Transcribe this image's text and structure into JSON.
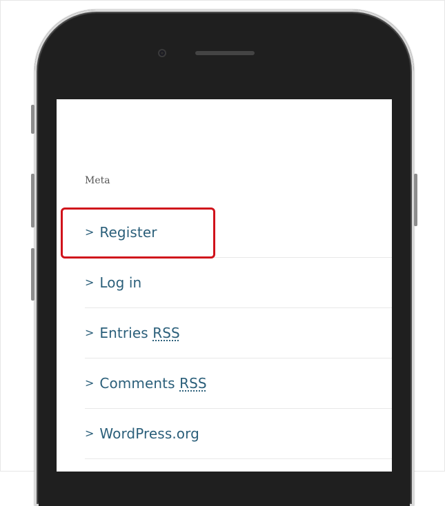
{
  "widget": {
    "title": "Meta",
    "items": [
      {
        "prefix": "Register",
        "abbr": ""
      },
      {
        "prefix": "Log in",
        "abbr": ""
      },
      {
        "prefix": "Entries ",
        "abbr": "RSS"
      },
      {
        "prefix": "Comments ",
        "abbr": "RSS"
      },
      {
        "prefix": "WordPress.org",
        "abbr": ""
      }
    ]
  },
  "icons": {
    "chevron": "chevron-right-icon",
    "camera": "front-camera-icon",
    "speaker": "earpiece-speaker-icon"
  },
  "colors": {
    "link": "#2b5f7a",
    "highlight": "#d0121b",
    "phone_body": "#262626"
  }
}
